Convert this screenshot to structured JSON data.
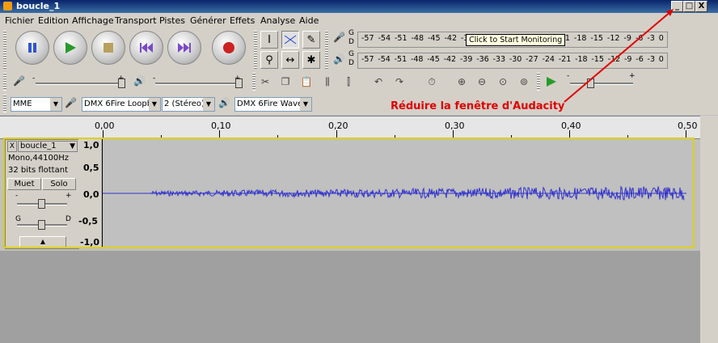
{
  "window": {
    "title": "boucle_1",
    "min": "_",
    "max": "□",
    "close": "X"
  },
  "menu": [
    "Fichier",
    "Edition",
    "Affichage",
    "Transport",
    "Pistes",
    "Générer",
    "Effets",
    "Analyse",
    "Aide"
  ],
  "meters": {
    "rec_ticks": [
      "-57",
      "-54",
      "-51",
      "-48",
      "-45",
      "-42",
      "-3",
      "-21",
      "-18",
      "-15",
      "-12",
      "-9",
      "-6",
      "-3",
      "0"
    ],
    "play_ticks": [
      "-57",
      "-54",
      "-51",
      "-48",
      "-45",
      "-42",
      "-39",
      "-36",
      "-33",
      "-30",
      "-27",
      "-24",
      "-21",
      "-18",
      "-15",
      "-12",
      "-9",
      "-6",
      "-3",
      "0"
    ],
    "tooltip": "Click to Start Monitoring",
    "ch_l": "G",
    "ch_r": "D"
  },
  "mixer": {
    "minus": "-",
    "plus": "+"
  },
  "device": {
    "host": "MME",
    "input": "DMX 6Fire Loopb",
    "channels": "2 (Stéreo)",
    "output": "DMX 6Fire Wave"
  },
  "annotation": {
    "text": "Réduire la fenêtre d'Audacity",
    "color": "#e00000"
  },
  "ruler": {
    "labels": [
      "0,00",
      "0,10",
      "0,20",
      "0,30",
      "0,40",
      "0,50"
    ]
  },
  "track": {
    "name": "boucle_1",
    "close": "X",
    "menu_arrow": "▼",
    "rate": "Mono,44100Hz",
    "format": "32 bits flottant",
    "mute": "Muet",
    "solo": "Solo",
    "gain_min": "-",
    "gain_max": "+",
    "pan_l": "G",
    "pan_r": "D",
    "collapse": "▲",
    "scale": [
      "1,0",
      "0,5",
      "0,0",
      "-0,5",
      "-1,0"
    ],
    "wave_color": "#3333cc"
  }
}
